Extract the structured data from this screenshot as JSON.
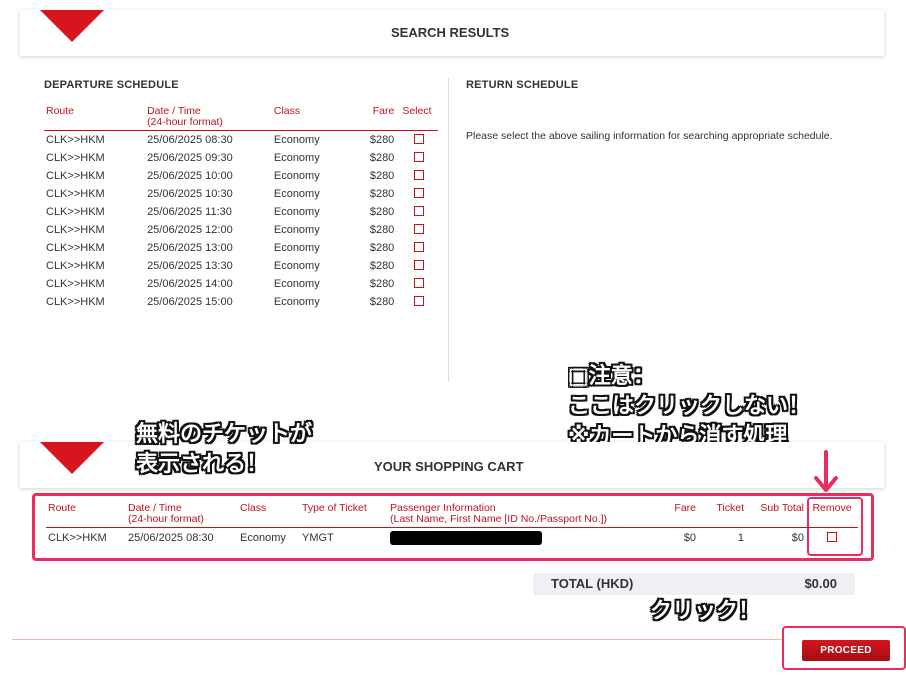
{
  "search_results": {
    "title": "SEARCH RESULTS"
  },
  "departure": {
    "heading": "DEPARTURE SCHEDULE",
    "columns": {
      "route": "Route",
      "datetime": "Date / Time",
      "datetime_sub": "(24-hour format)",
      "class": "Class",
      "fare": "Fare",
      "select": "Select"
    },
    "rows": [
      {
        "route": "CLK>>HKM",
        "datetime": "25/06/2025 08:30",
        "class": "Economy",
        "fare": "$280"
      },
      {
        "route": "CLK>>HKM",
        "datetime": "25/06/2025 09:30",
        "class": "Economy",
        "fare": "$280"
      },
      {
        "route": "CLK>>HKM",
        "datetime": "25/06/2025 10:00",
        "class": "Economy",
        "fare": "$280"
      },
      {
        "route": "CLK>>HKM",
        "datetime": "25/06/2025 10:30",
        "class": "Economy",
        "fare": "$280"
      },
      {
        "route": "CLK>>HKM",
        "datetime": "25/06/2025 11:30",
        "class": "Economy",
        "fare": "$280"
      },
      {
        "route": "CLK>>HKM",
        "datetime": "25/06/2025 12:00",
        "class": "Economy",
        "fare": "$280"
      },
      {
        "route": "CLK>>HKM",
        "datetime": "25/06/2025 13:00",
        "class": "Economy",
        "fare": "$280"
      },
      {
        "route": "CLK>>HKM",
        "datetime": "25/06/2025 13:30",
        "class": "Economy",
        "fare": "$280"
      },
      {
        "route": "CLK>>HKM",
        "datetime": "25/06/2025 14:00",
        "class": "Economy",
        "fare": "$280"
      },
      {
        "route": "CLK>>HKM",
        "datetime": "25/06/2025 15:00",
        "class": "Economy",
        "fare": "$280"
      }
    ]
  },
  "return": {
    "heading": "RETURN SCHEDULE",
    "message": "Please select the above sailing information for searching appropriate schedule."
  },
  "cart": {
    "title": "YOUR SHOPPING CART",
    "columns": {
      "route": "Route",
      "datetime": "Date / Time",
      "datetime_sub": "(24-hour format)",
      "class": "Class",
      "ticket_type": "Type of Ticket",
      "passenger": "Passenger Information",
      "passenger_sub": "(Last Name, First Name [ID No./Passport No.])",
      "fare": "Fare",
      "ticket": "Ticket",
      "subtotal": "Sub Total",
      "remove": "Remove"
    },
    "row": {
      "route": "CLK>>HKM",
      "datetime": "25/06/2025 08:30",
      "class": "Economy",
      "ticket_type": "YMGT",
      "fare": "$0",
      "ticket": "1",
      "subtotal": "$0"
    },
    "total_label": "TOTAL (HKD)",
    "total_value": "$0.00",
    "proceed_label": "PROCEED"
  },
  "annotations": {
    "free_ticket": [
      "無料のチケットが",
      "表示される！"
    ],
    "warning": [
      "□注意：",
      "ここはクリックしない！",
      "※カートから消す処理"
    ],
    "click": "クリック！"
  },
  "colors": {
    "accent": "#d8141e",
    "annotation_box": "#ea2d5c"
  }
}
